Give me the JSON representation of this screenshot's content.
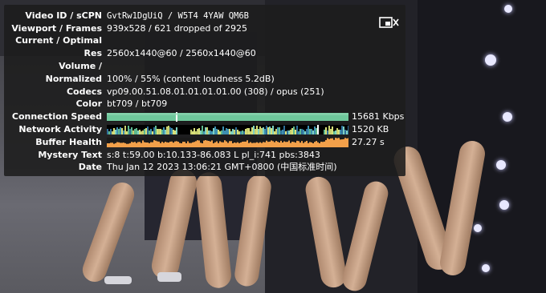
{
  "stats": {
    "rows": [
      {
        "label": "Video ID / sCPN",
        "value": "GvtRw1DgUiQ  /  W5T4 4YAW QM6B"
      },
      {
        "label": "Viewport / Frames",
        "value": "939x528 / 621 dropped of 2925"
      },
      {
        "label": "Current / Optimal",
        "value": ""
      },
      {
        "label": "Res",
        "value": "2560x1440@60 / 2560x1440@60"
      },
      {
        "label": "Volume /",
        "value": ""
      },
      {
        "label": "Normalized",
        "value": "100% / 55% (content loudness 5.2dB)"
      },
      {
        "label": "Codecs",
        "value": "vp09.00.51.08.01.01.01.01.00 (308) / opus (251)"
      },
      {
        "label": "Color",
        "value": "bt709 / bt709"
      }
    ],
    "graphs": [
      {
        "label": "Connection Speed",
        "value": "15681 Kbps",
        "color": "#5fb88d"
      },
      {
        "label": "Network Activity",
        "value": "1520 KB",
        "color": "#3e8fb0"
      },
      {
        "label": "Buffer Health",
        "value": "27.27 s",
        "color": "#f2a04a"
      }
    ],
    "tail_rows": [
      {
        "label": "Mystery Text",
        "value": "s:8 t:59.00 b:10.133-86.083 L pl_i:741 pbs:3843"
      },
      {
        "label": "Date",
        "value": "Thu Jan 12 2023 13:06:21 GMT+0800 (中国标准时间)"
      }
    ],
    "close_icon": "close-icon"
  }
}
